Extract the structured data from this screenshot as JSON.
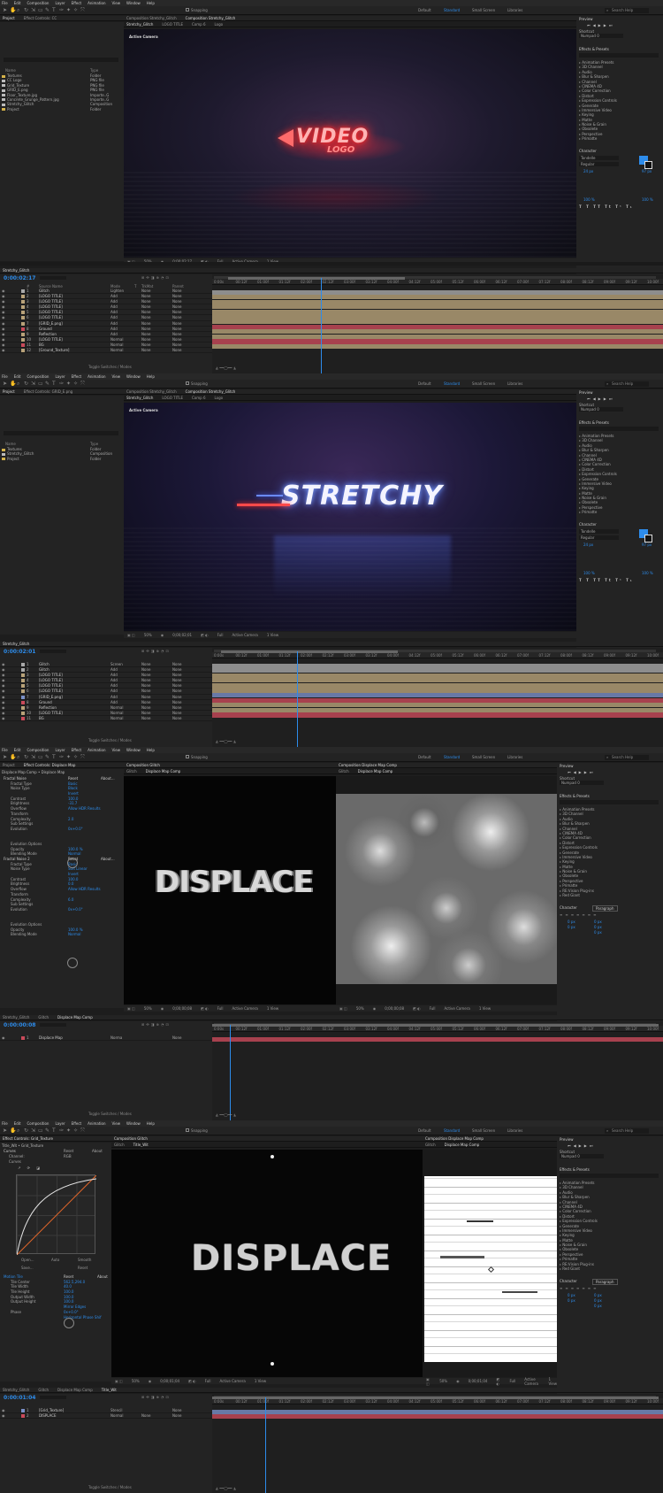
{
  "menu": [
    "File",
    "Edit",
    "Composition",
    "Layer",
    "Effect",
    "Animation",
    "View",
    "Window",
    "Help"
  ],
  "toolbar": {
    "snapping": "Snapping",
    "workspaces": [
      "Default",
      "Standard",
      "Small Screen",
      "Libraries"
    ],
    "active_workspace": "Standard",
    "search_placeholder": "Search Help"
  },
  "right_panel": {
    "preview_title": "Preview",
    "shortcut_label": "Shortcut",
    "shortcut_value": "Numpad 0",
    "effects_title": "Effects & Presets",
    "effects": [
      "Animation Presets",
      "3D Channel",
      "Audio",
      "Blur & Sharpen",
      "Channel",
      "CINEMA 4D",
      "Color Correction",
      "Distort",
      "Expression Controls",
      "Generate",
      "Immersive Video",
      "Keying",
      "Matte",
      "Noise & Grain",
      "Obsolete",
      "Perspective",
      "Primatte"
    ],
    "effects_alt": [
      "Animation Presets",
      "3D Channel",
      "Audio",
      "Blur & Sharpen",
      "Channel",
      "CINEMA 4D",
      "Color Correction",
      "Distort",
      "Expression Controls",
      "Generate",
      "Immersive Video",
      "Keying",
      "Matte",
      "Noise & Grain",
      "Obsolete",
      "Perspective",
      "Primatte",
      "RE:Vision Plug-ins",
      "Red Giant"
    ],
    "character_title": "Character",
    "paragraph_title": "Paragraph",
    "font_name": "Tondelle",
    "font_style": "Regular",
    "font_size": "24 px",
    "tracking": "97 px",
    "scale_v": "100 %",
    "scale_h": "100 %",
    "para_values": [
      "0 px",
      "0 px",
      "0 px",
      "0 px",
      "0 px"
    ]
  },
  "shot1": {
    "tabs_left": [
      "Project",
      "Effect Controls: CC"
    ],
    "comp_tabs": [
      "Composition Stretchy_Glitch",
      "Composition Stretchy_Glitch"
    ],
    "comp_subtabs": [
      "Stretchy_Glitch",
      "LOGO TITLE",
      "Comp 6",
      "Logo"
    ],
    "renderer": "Renderer:",
    "renderer_value": "Classic 3D",
    "active_camera": "Active Camera",
    "project_headers": [
      "Name",
      "Type"
    ],
    "project_items": [
      {
        "name": "Textures",
        "type": "Folder",
        "color": "#d4b24a"
      },
      {
        "name": "CC Logo",
        "type": "PNG file",
        "color": "#bbb"
      },
      {
        "name": "Grid_Texture",
        "type": "PNG file",
        "color": "#bbb"
      },
      {
        "name": "GRID_E.png",
        "type": "PNG file",
        "color": "#bbb"
      },
      {
        "name": "Floor_Texture.jpg",
        "type": "Importe..G",
        "color": "#bbb"
      },
      {
        "name": "Concrete_Grunge_Pattern.jpg",
        "type": "Importe..G",
        "color": "#bbb"
      },
      {
        "name": "Stretchy_Glitch",
        "type": "Composition",
        "color": "#bbb"
      },
      {
        "name": "Project",
        "type": "Folder",
        "color": "#d4b24a"
      }
    ],
    "viewer_zoom": "50%",
    "timecode_small": "0;00;02;17",
    "viewer_quality": "Full",
    "view_count": "1 View",
    "comp_name": "Stretchy_Glitch",
    "timecode": "0:00:02:17",
    "logo_line1": "VIDEO",
    "logo_line2": "LOGO",
    "layer_headers": [
      "#",
      "Source Name",
      "Mode",
      "T",
      "TrkMat",
      "Parent"
    ],
    "layers": [
      {
        "num": "1",
        "name": "Glitch",
        "mode": "Lighten",
        "trk": "None",
        "parent": "None",
        "color": "#a9a9a9"
      },
      {
        "num": "2",
        "name": "[LOGO TITLE]",
        "mode": "Add",
        "trk": "None",
        "parent": "None",
        "color": "#b8a279"
      },
      {
        "num": "3",
        "name": "[LOGO TITLE]",
        "mode": "Add",
        "trk": "None",
        "parent": "None",
        "color": "#b8a279"
      },
      {
        "num": "4",
        "name": "[LOGO TITLE]",
        "mode": "Add",
        "trk": "None",
        "parent": "None",
        "color": "#b8a279"
      },
      {
        "num": "5",
        "name": "[LOGO TITLE]",
        "mode": "Add",
        "trk": "None",
        "parent": "None",
        "color": "#b8a279"
      },
      {
        "num": "6",
        "name": "[LOGO TITLE]",
        "mode": "Add",
        "trk": "None",
        "parent": "None",
        "color": "#b8a279"
      },
      {
        "num": "7",
        "name": "[GRID_E.png]",
        "mode": "Add",
        "trk": "None",
        "parent": "None",
        "color": "#b8a279"
      },
      {
        "num": "8",
        "name": "Ground",
        "mode": "Add",
        "trk": "None",
        "parent": "None",
        "color": "#c94a5a"
      },
      {
        "num": "9",
        "name": "Reflection",
        "mode": "Add",
        "trk": "None",
        "parent": "None",
        "color": "#b8a279"
      },
      {
        "num": "10",
        "name": "[LOGO TITLE]",
        "mode": "Normal",
        "trk": "None",
        "parent": "None",
        "color": "#b8a279"
      },
      {
        "num": "11",
        "name": "BG",
        "mode": "Normal",
        "trk": "None",
        "parent": "None",
        "color": "#c94a5a"
      },
      {
        "num": "12",
        "name": "[Ground_Texture]",
        "mode": "Normal",
        "trk": "None",
        "parent": "None",
        "color": "#b8a279"
      }
    ],
    "toggle": "Toggle Switches / Modes",
    "ruler": [
      "0:00s",
      "00:12f",
      "01:00f",
      "01:12f",
      "02:00f",
      "02:12f",
      "03:00f",
      "03:12f",
      "04:00f",
      "04:12f",
      "05:00f",
      "05:12f",
      "06:00f",
      "06:12f",
      "07:00f",
      "07:12f",
      "08:00f",
      "08:12f",
      "09:00f",
      "09:12f",
      "10:00f"
    ]
  },
  "shot2": {
    "tabs_left": [
      "Project",
      "Effect Controls: GRID_E.png"
    ],
    "comp_tabs": [
      "Composition Stretchy_Glitch",
      "Composition Stretchy_Glitch"
    ],
    "comp_subtabs": [
      "Stretchy_Glitch",
      "LOGO TITLE",
      "Comp 6",
      "Logo"
    ],
    "renderer": "Renderer:",
    "renderer_value": "Classic 3D",
    "active_camera": "Active Camera",
    "project_headers": [
      "Name",
      "Type"
    ],
    "project_items": [
      {
        "name": "Textures",
        "type": "Folder",
        "color": "#d4b24a"
      },
      {
        "name": "Stretchy_Glitch",
        "type": "Composition",
        "color": "#bbb"
      },
      {
        "name": "Project",
        "type": "Folder",
        "color": "#d4b24a"
      }
    ],
    "viewer_zoom": "50%",
    "timecode_small": "0;00;02;01",
    "viewer_quality": "Full",
    "view_count": "1 View",
    "comp_name": "Stretchy_Glitch",
    "timecode": "0:00:02:01",
    "title_text": "STRETCHY",
    "layers": [
      {
        "num": "1",
        "name": "Glitch",
        "mode": "Screen",
        "trk": "None",
        "parent": "None",
        "color": "#a9a9a9"
      },
      {
        "num": "2",
        "name": "Glitch",
        "mode": "Add",
        "trk": "None",
        "parent": "None",
        "color": "#a9a9a9"
      },
      {
        "num": "3",
        "name": "[LOGO TITLE]",
        "mode": "Add",
        "trk": "None",
        "parent": "None",
        "color": "#b8a279"
      },
      {
        "num": "4",
        "name": "[LOGO TITLE]",
        "mode": "Add",
        "trk": "None",
        "parent": "None",
        "color": "#b8a279"
      },
      {
        "num": "5",
        "name": "[LOGO TITLE]",
        "mode": "Add",
        "trk": "None",
        "parent": "None",
        "color": "#b8a279"
      },
      {
        "num": "6",
        "name": "[LOGO TITLE]",
        "mode": "Add",
        "trk": "None",
        "parent": "None",
        "color": "#b8a279"
      },
      {
        "num": "7",
        "name": "[GRID_E.png]",
        "mode": "Add",
        "trk": "None",
        "parent": "None",
        "color": "#7a90c8"
      },
      {
        "num": "8",
        "name": "Ground",
        "mode": "Add",
        "trk": "None",
        "parent": "None",
        "color": "#c94a5a"
      },
      {
        "num": "9",
        "name": "Reflection",
        "mode": "Normal",
        "trk": "None",
        "parent": "None",
        "color": "#b8a279"
      },
      {
        "num": "10",
        "name": "[LOGO TITLE]",
        "mode": "Normal",
        "trk": "None",
        "parent": "None",
        "color": "#b8a279"
      },
      {
        "num": "11",
        "name": "BG",
        "mode": "Normal",
        "trk": "None",
        "parent": "None",
        "color": "#c94a5a"
      }
    ],
    "toggle": "Toggle Switches / Modes"
  },
  "shot3": {
    "tabs_left": [
      "Project",
      "Effect Controls: Displace Map"
    ],
    "fx_path": "Displace Map Comp • Displace Map",
    "fx_items": [
      {
        "label": "Fractal Noise",
        "val": "Reset",
        "extra": "About...",
        "hdr": true
      },
      {
        "label": "Fractal Type",
        "val": "Basic"
      },
      {
        "label": "Noise Type",
        "val": "Block"
      },
      {
        "label": "",
        "val": "Invert"
      },
      {
        "label": "Contrast",
        "val": "100.0"
      },
      {
        "label": "Brightness",
        "val": "-31.7"
      },
      {
        "label": "Overflow",
        "val": "Allow HDR Results"
      },
      {
        "label": "Transform",
        "val": ""
      },
      {
        "label": "Complexity",
        "val": "2.0"
      },
      {
        "label": "Sub Settings",
        "val": ""
      },
      {
        "label": "Evolution",
        "val": "0x+0.0°"
      },
      {
        "label": "",
        "val": ""
      },
      {
        "label": "",
        "val": ""
      },
      {
        "label": "Evolution Options",
        "val": ""
      },
      {
        "label": "Opacity",
        "val": "100.0 %"
      },
      {
        "label": "Blending Mode",
        "val": "Normal"
      },
      {
        "label": "Fractal Noise 2",
        "val": "Reset",
        "extra": "About...",
        "hdr": true
      },
      {
        "label": "Fractal Type",
        "val": "Basic"
      },
      {
        "label": "Noise Type",
        "val": "Soft Linear"
      },
      {
        "label": "",
        "val": "Invert"
      },
      {
        "label": "Contrast",
        "val": "100.0"
      },
      {
        "label": "Brightness",
        "val": "0.0"
      },
      {
        "label": "Overflow",
        "val": "Allow HDR Results"
      },
      {
        "label": "Transform",
        "val": ""
      },
      {
        "label": "Complexity",
        "val": "6.0"
      },
      {
        "label": "Sub Settings",
        "val": ""
      },
      {
        "label": "Evolution",
        "val": "0x+0.0°"
      },
      {
        "label": "",
        "val": ""
      },
      {
        "label": "",
        "val": ""
      },
      {
        "label": "Evolution Options",
        "val": ""
      },
      {
        "label": "Opacity",
        "val": "100.0 %"
      },
      {
        "label": "Blending Mode",
        "val": "Normal"
      }
    ],
    "comp_tab_left": "Composition Glitch",
    "subtabs_left": [
      "Glitch",
      "Displace Map Comp"
    ],
    "comp_tab_right": "Composition Displace Map Comp",
    "subtabs_right": [
      "Glitch",
      "Displace Map Comp"
    ],
    "title_text": "DISPLACE",
    "viewer_zoom": "50%",
    "timecode_small": "0;00;00;08",
    "viewer_quality": "Full",
    "active_camera": "Active Camera",
    "view_count": "1 View",
    "comp_tabs_bottom": [
      "Stretchy_Glitch",
      "Glitch",
      "Displace Map Comp"
    ],
    "timecode": "0:00:00:08",
    "layers": [
      {
        "num": "1",
        "name": "Displace Map",
        "mode": "Norma",
        "trk": "",
        "parent": "None",
        "color": "#c94a5a"
      }
    ],
    "toggle": "Toggle Switches / Modes",
    "ruler": [
      "0:00s",
      "00:12f",
      "01:00f",
      "01:12f",
      "02:00f",
      "02:12f",
      "03:00f",
      "03:12f",
      "04:00f",
      "04:12f",
      "05:00f",
      "05:12f",
      "06:00f",
      "06:12f",
      "07:00f",
      "07:12f",
      "08:00f",
      "08:12f",
      "09:00f",
      "09:12f",
      "10:00f"
    ]
  },
  "shot4": {
    "tabs_left": [
      "Effect Controls: Grid_Texture"
    ],
    "fx_path": "Title_Wit • Grid_Texture",
    "curves": {
      "label": "Curves",
      "reset": "Reset",
      "about": "About",
      "channel_label": "Channel:",
      "channel": "RGB",
      "curve_label": "Curves"
    },
    "curve_buttons": [
      "Open...",
      "Auto",
      "Smooth",
      "Save...",
      "Reset"
    ],
    "tile_items": [
      {
        "label": "Motion Tile",
        "val": "Reset",
        "extra": "About",
        "hdr": true
      },
      {
        "label": "Tile Center",
        "val": "562.5,294.0"
      },
      {
        "label": "Tile Width",
        "val": "40.0"
      },
      {
        "label": "Tile Height",
        "val": "100.0"
      },
      {
        "label": "Output Width",
        "val": "100.0"
      },
      {
        "label": "Output Height",
        "val": "100.0"
      },
      {
        "label": "",
        "val": "Mirror Edges"
      },
      {
        "label": "Phase",
        "val": "0x+0.0°"
      },
      {
        "label": "",
        "val": "Horizontal Phase Shif"
      }
    ],
    "comp_tab_left": "Composition Glitch",
    "subtabs_left": [
      "Glitch",
      "Title_Wit"
    ],
    "comp_tab_right": "Composition Displace Map Comp",
    "subtabs_right": [
      "Glitch",
      "Displace Map Comp"
    ],
    "title_text": "DISPLACE",
    "viewer_zoom": "50%",
    "timecode_small": "0;00;01;04",
    "viewer_quality": "Full",
    "active_camera": "Active Camera",
    "view_count": "1 View",
    "comp_tabs_bottom": [
      "Stretchy_Glitch",
      "Glitch",
      "Displace Map Comp",
      "Title_Wit"
    ],
    "timecode": "0:00:01:04",
    "layers": [
      {
        "num": "1",
        "name": "[Grid_Texture]",
        "mode": "Stencil",
        "trk": "",
        "parent": "None",
        "color": "#7a90c8"
      },
      {
        "num": "2",
        "name": "DISPLACE",
        "mode": "Normal",
        "trk": "None",
        "parent": "None",
        "color": "#c94a5a"
      }
    ],
    "toggle": "Toggle Switches / Modes"
  }
}
